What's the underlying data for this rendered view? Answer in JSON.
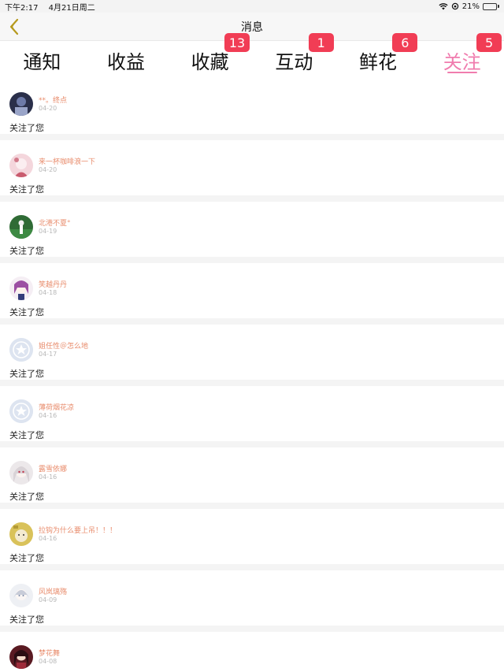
{
  "status_bar": {
    "time": "下午2:17",
    "date": "4月21日周二",
    "battery": "21%",
    "battery_level": 0.21
  },
  "nav": {
    "title": "消息"
  },
  "tabs": [
    {
      "label": "通知",
      "badge": ""
    },
    {
      "label": "收益",
      "badge": ""
    },
    {
      "label": "收藏",
      "badge": "13"
    },
    {
      "label": "互动",
      "badge": "1"
    },
    {
      "label": "鲜花",
      "badge": "6"
    },
    {
      "label": "关注",
      "badge": "5"
    }
  ],
  "active_tab": "关注",
  "items": [
    {
      "name": "**。终点",
      "date": "04-20",
      "action": "关注了您"
    },
    {
      "name": "来一杯咖啡浪一下",
      "date": "04-20",
      "action": "关注了您"
    },
    {
      "name": "北港不夏°",
      "date": "04-19",
      "action": "关注了您"
    },
    {
      "name": "笑越丹丹",
      "date": "04-18",
      "action": "关注了您"
    },
    {
      "name": "姐任性＠怎么地",
      "date": "04-17",
      "action": "关注了您"
    },
    {
      "name": "薄荷烟花凉",
      "date": "04-16",
      "action": "关注了您"
    },
    {
      "name": "露雪依娜",
      "date": "04-16",
      "action": "关注了您"
    },
    {
      "name": "拉钩为什么要上吊！！！",
      "date": "04-16",
      "action": "关注了您"
    },
    {
      "name": "风岚璃殇",
      "date": "04-09",
      "action": "关注了您"
    },
    {
      "name": "梦花舞",
      "date": "04-08",
      "action": ""
    }
  ],
  "colors": {
    "accent": "#f07cae",
    "badge": "#f13d55",
    "username": "#e88b6b",
    "back_arrow": "#b69a1e"
  }
}
